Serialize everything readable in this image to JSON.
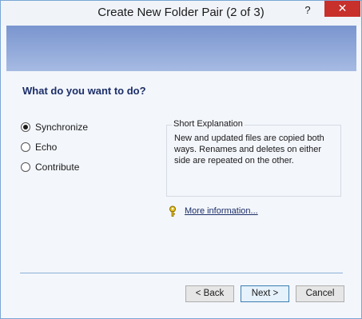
{
  "window": {
    "title": "Create New Folder Pair (2 of 3)"
  },
  "titlebar": {
    "help_label": "?",
    "close_label": "✕"
  },
  "colors": {
    "banner": "#7a95cf",
    "close": "#c7302b",
    "heading": "#1b2e68",
    "divider": "#8fb1d8"
  },
  "page": {
    "heading": "What do you want to do?",
    "options": [
      {
        "label": "Synchronize",
        "selected": true
      },
      {
        "label": "Echo",
        "selected": false
      },
      {
        "label": "Contribute",
        "selected": false
      }
    ],
    "explanation": {
      "title": "Short Explanation",
      "text": "New and updated files are copied both ways. Renames and deletes on either side are repeated on the other."
    },
    "more_info": {
      "icon": "key-icon",
      "label": "More information..."
    }
  },
  "buttons": {
    "back": "< Back",
    "next": "Next >",
    "cancel": "Cancel"
  }
}
